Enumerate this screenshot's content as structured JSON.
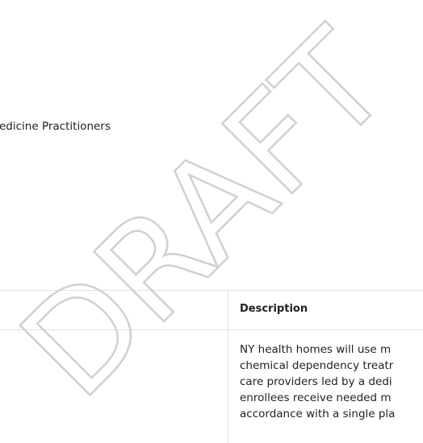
{
  "body": {
    "practitioners_text": "edicine Practitioners"
  },
  "table": {
    "header_description": "Description",
    "description_lines": [
      "NY health homes will use m",
      "chemical dependency treatr",
      "care providers led by a dedi",
      "enrollees receive needed m",
      "accordance with a single pla"
    ]
  },
  "watermark": {
    "text": "DRAFT",
    "color": "#d0d0d0"
  }
}
